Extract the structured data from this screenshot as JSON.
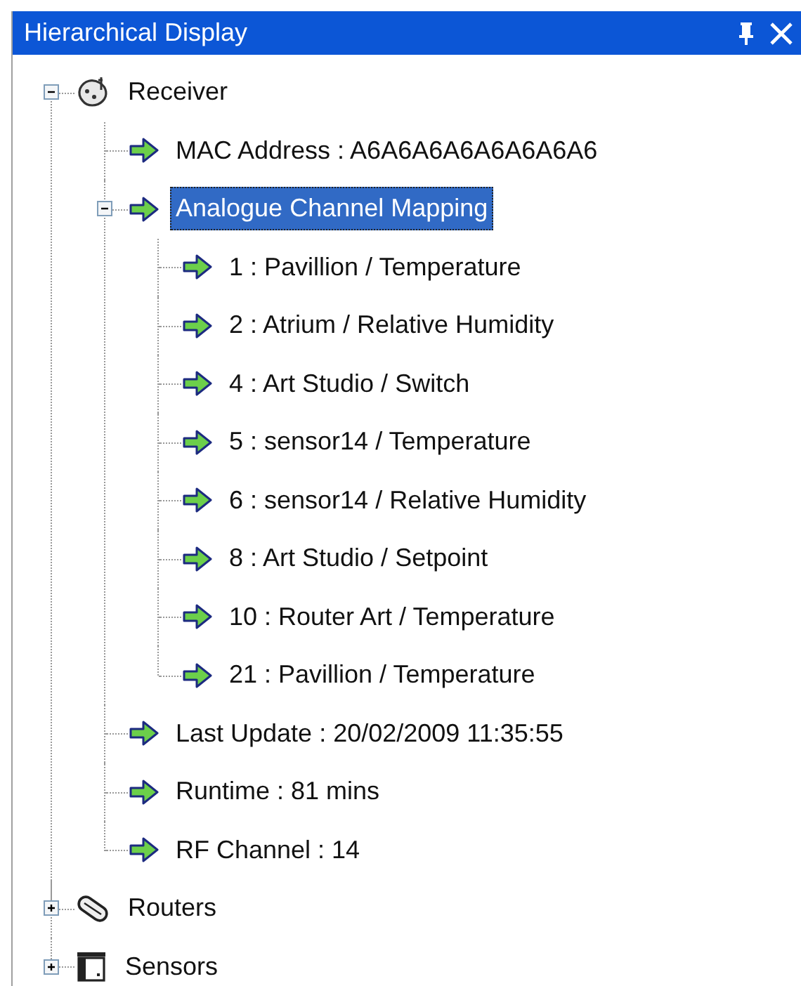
{
  "window": {
    "title": "Hierarchical Display"
  },
  "tree": [
    {
      "kind": "receiver",
      "label": "Receiver",
      "expanded": true,
      "selected": false,
      "children": [
        {
          "kind": "property",
          "label": "MAC Address : A6A6A6A6A6A6A6A6",
          "selected": false
        },
        {
          "kind": "property",
          "label": "Analogue Channel Mapping",
          "expanded": true,
          "selected": true,
          "children": [
            {
              "kind": "property",
              "label": "1 : Pavillion / Temperature",
              "selected": false
            },
            {
              "kind": "property",
              "label": "2 : Atrium / Relative Humidity",
              "selected": false
            },
            {
              "kind": "property",
              "label": "4 : Art Studio / Switch",
              "selected": false
            },
            {
              "kind": "property",
              "label": "5 : sensor14 / Temperature",
              "selected": false
            },
            {
              "kind": "property",
              "label": "6 : sensor14 / Relative Humidity",
              "selected": false
            },
            {
              "kind": "property",
              "label": "8 : Art Studio / Setpoint",
              "selected": false
            },
            {
              "kind": "property",
              "label": "10 : Router Art / Temperature",
              "selected": false
            },
            {
              "kind": "property",
              "label": "21 : Pavillion / Temperature",
              "selected": false
            }
          ]
        },
        {
          "kind": "property",
          "label": "Last Update : 20/02/2009 11:35:55",
          "selected": false
        },
        {
          "kind": "property",
          "label": "Runtime : 81 mins",
          "selected": false
        },
        {
          "kind": "property",
          "label": "RF Channel : 14",
          "selected": false
        }
      ]
    },
    {
      "kind": "router",
      "label": "Routers",
      "expanded": false,
      "selected": false
    },
    {
      "kind": "sensor",
      "label": "Sensors",
      "expanded": false,
      "selected": false
    }
  ]
}
